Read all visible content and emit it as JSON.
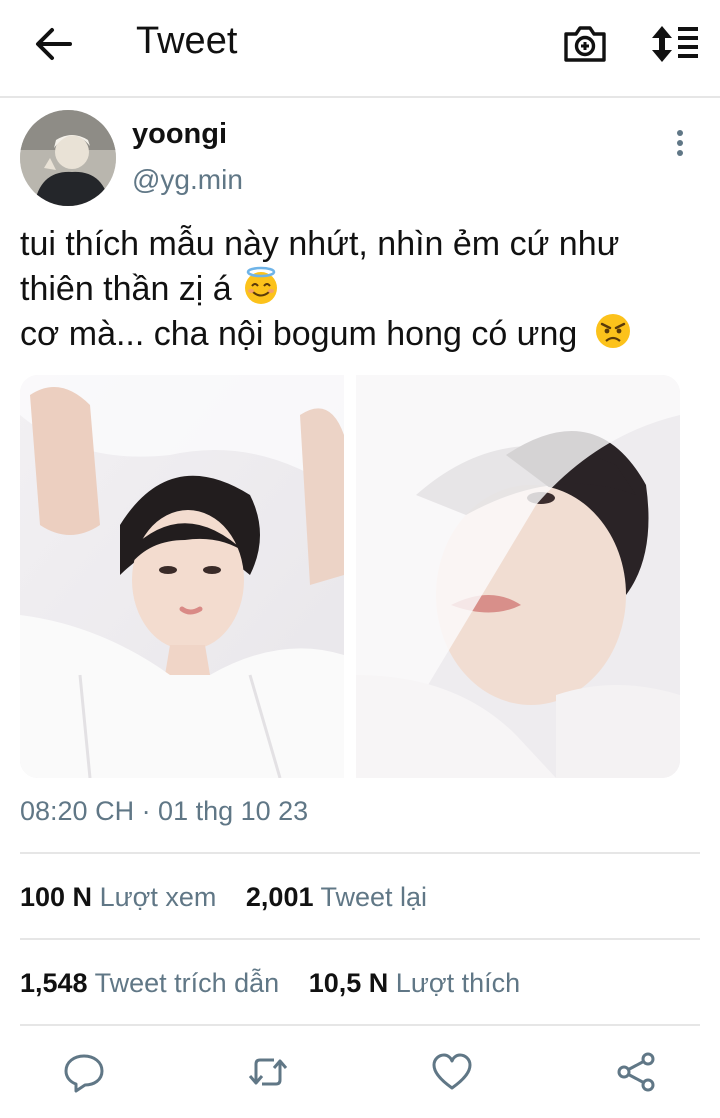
{
  "header": {
    "title": "Tweet"
  },
  "tweet": {
    "display_name": "yoongi",
    "handle": "@yg.min",
    "text_line1": "tui thích mẫu này nhứt, nhìn ẻm cứ như",
    "text_line2": "thiên thần zị á",
    "text_line3": "cơ mà... cha nội bogum hong có ưng",
    "emoji_1": "smiling-face-with-halo",
    "emoji_2": "angry-face",
    "timestamp": "08:20 CH · 01 thg 10 23"
  },
  "stats": {
    "views_count": "100 N",
    "views_label": "Lượt xem",
    "retweets_count": "2,001",
    "retweets_label": "Tweet lại",
    "quotes_count": "1,548",
    "quotes_label": "Tweet trích dẫn",
    "likes_count": "10,5 N",
    "likes_label": "Lượt thích"
  },
  "icons": {
    "back": "arrow-left-icon",
    "camera": "camera-icon",
    "sort": "sort-icon",
    "more": "more-vertical-icon",
    "reply": "reply-icon",
    "retweet": "retweet-icon",
    "like": "heart-icon",
    "share": "share-icon"
  },
  "colors": {
    "secondary_text": "#607786",
    "divider": "#e6e6e6",
    "icon": "#607786"
  }
}
